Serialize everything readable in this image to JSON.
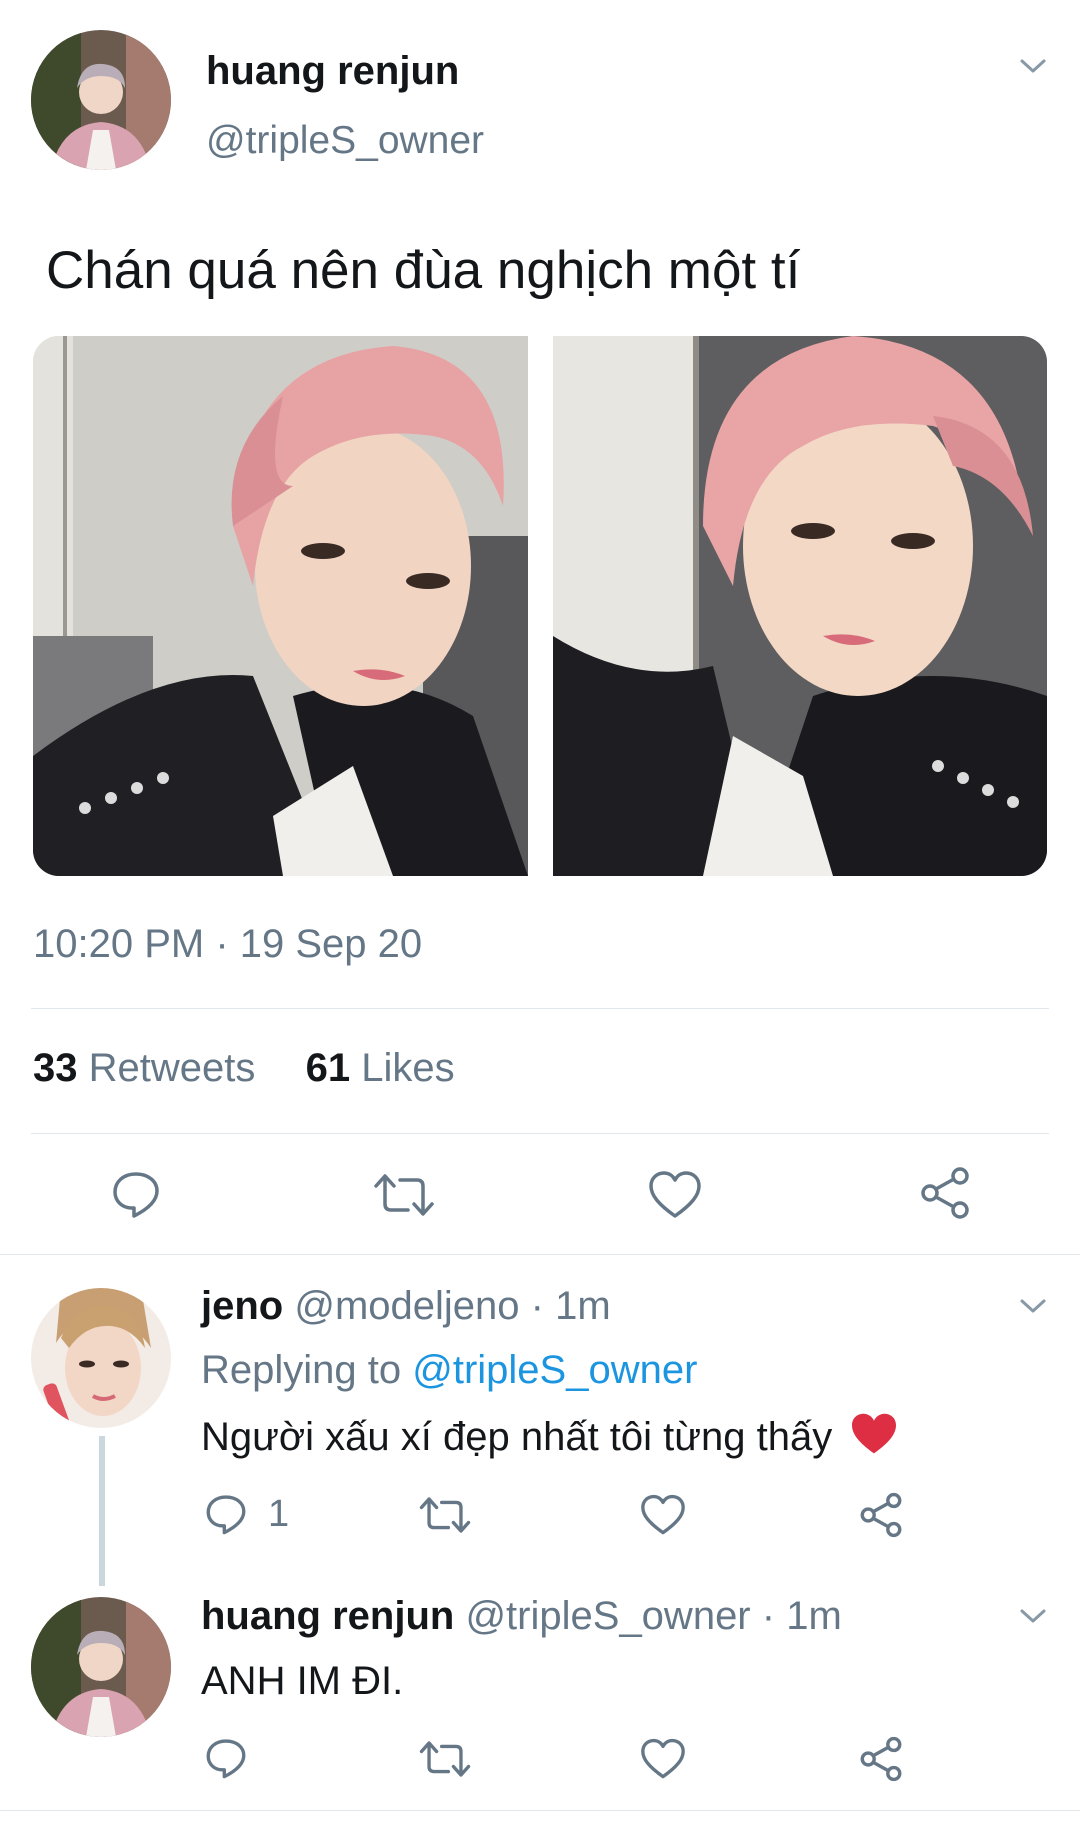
{
  "tweet": {
    "author_name": "huang renjun",
    "author_handle": "@tripleS_owner",
    "text": "Chán quá nên đùa nghịch một tí",
    "time": "10:20 PM · 19 Sep 20",
    "retweet_count": "33",
    "retweet_label": "Retweets",
    "like_count": "61",
    "like_label": "Likes"
  },
  "replies": [
    {
      "name": "jeno",
      "handle": "@modeljeno",
      "time": "· 1m",
      "replying_prefix": "Replying to",
      "replying_handle": "@tripleS_owner",
      "text": "Người xấu xí đẹp nhất tôi từng thấy",
      "emoji": "❤️",
      "reply_count": "1"
    },
    {
      "name": "huang renjun",
      "handle": "@tripleS_owner",
      "time": "· 1m",
      "text": "ANH IM ĐI."
    }
  ],
  "icons": {
    "reply": "comment-icon",
    "retweet": "retweet-icon",
    "like": "heart-icon",
    "share": "share-icon",
    "more": "chevron-down-icon"
  },
  "colors": {
    "text": "#14171a",
    "secondary": "#657786",
    "link": "#1b95e0",
    "heart": "#e0245e",
    "divider": "#e1e8ed"
  }
}
